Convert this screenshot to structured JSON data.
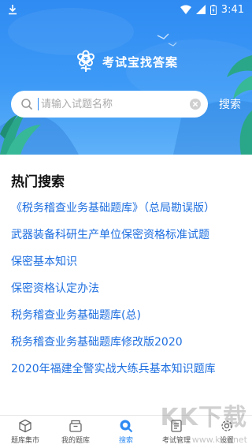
{
  "status_bar": {
    "time": "3:41",
    "icons": [
      "download-icon",
      "wifi-icon",
      "signal-icon",
      "battery-icon"
    ]
  },
  "header": {
    "app_title": "考试宝找答案",
    "search_placeholder": "请输入试题名称",
    "search_button": "搜索",
    "colors": {
      "gradient_top": "#2f8bf2",
      "gradient_bottom": "#5fb1f8"
    }
  },
  "hot_search": {
    "title": "热门搜索",
    "items": [
      "《税务稽查业务基础题库》（总局勘误版）",
      "武器装备科研生产单位保密资格标准试题",
      "保密基本知识",
      "保密资格认定办法",
      "税务稽查业务基础题库(总)",
      "税务稽查业务基础题库修改版2020",
      "2020年福建全警实战大练兵基本知识题库"
    ],
    "link_color": "#1f6fe0"
  },
  "bottom_nav": {
    "items": [
      {
        "label": "题库集市",
        "icon": "cube-icon"
      },
      {
        "label": "我的题库",
        "icon": "box-icon"
      },
      {
        "label": "搜索",
        "icon": "search-icon",
        "active": true
      },
      {
        "label": "考试管理",
        "icon": "exam-icon"
      },
      {
        "label": "设置",
        "icon": "settings-icon"
      }
    ],
    "active_color": "#2f8bf2"
  },
  "watermark": {
    "text": "KK下载",
    "url": "www.kkx.net"
  }
}
